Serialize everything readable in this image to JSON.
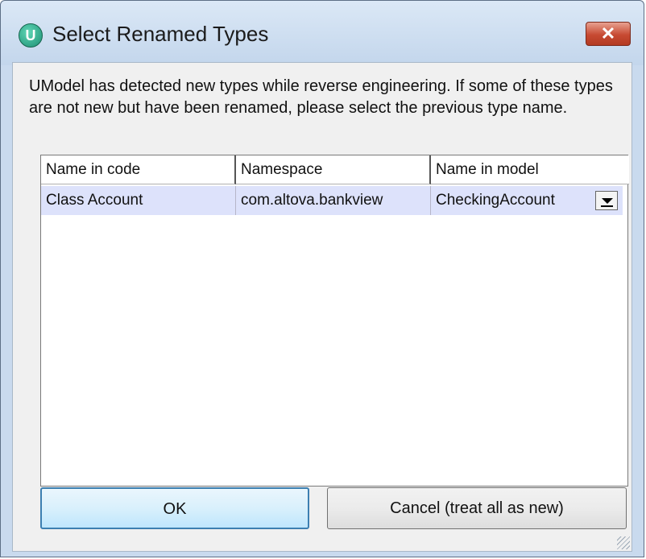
{
  "window": {
    "title": "Select Renamed Types",
    "icon": "umodel-app-icon",
    "close_label": "✕"
  },
  "message": "UModel has detected new types while reverse engineering. If some of these types are not new but have been renamed, please select the previous type name.",
  "grid": {
    "columns": [
      "Name in code",
      "Namespace",
      "Name in model"
    ],
    "rows": [
      {
        "name_in_code": "Class Account",
        "namespace": "com.altova.bankview",
        "name_in_model": "CheckingAccount"
      }
    ]
  },
  "buttons": {
    "ok": "OK",
    "cancel": "Cancel (treat all as new)"
  },
  "colors": {
    "selected_row": "#dde2fb",
    "close_button": "#c74a32",
    "ok_border": "#3c7fb1"
  }
}
